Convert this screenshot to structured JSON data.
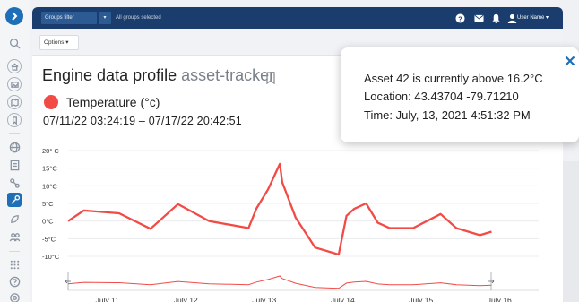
{
  "colors": {
    "topbar": "#1b3d6d",
    "accent": "#1f6fb8",
    "series": "#f24b46"
  },
  "toolbar": {
    "groups_filter": "Groups filter",
    "groups_caret": "▾",
    "groups_selected": "All groups selected",
    "icons": [
      "help-icon",
      "mail-icon",
      "bell-icon",
      "user-icon"
    ],
    "user_name": "User Name ▾",
    "options_label": "Options ▾"
  },
  "sidebar": {
    "items": [
      "expand-icon",
      "search-icon",
      "home-icon",
      "image-icon",
      "map-icon",
      "bookmark-icon",
      "globe-icon",
      "document-icon",
      "link-icon",
      "tools-icon",
      "leaf-icon",
      "people-icon",
      "grid-icon",
      "help-icon",
      "settings-icon"
    ]
  },
  "page": {
    "title": "Engine data profile",
    "asset": "asset-tracker",
    "legend_label": "Temperature (°c)",
    "date_range": "07/11/22 03:24:19 – 07/17/22 20:42:51"
  },
  "popup": {
    "line1": "Asset 42 is currently above 16.2°C",
    "line2": "Location: 43.43704  -79.71210",
    "line3": "Time: July, 13, 2021 4:51:32 PM"
  },
  "chart_data": {
    "type": "line",
    "title": "",
    "xlabel": "",
    "ylabel": "",
    "y_tick_labels": [
      "20° C",
      "15°C",
      "10°C",
      "5°C",
      "0°C",
      "-5°C",
      "-10°C"
    ],
    "x_tick_labels": [
      "July 11",
      "July 12",
      "July 13",
      "July 14",
      "July 15",
      "July 16"
    ],
    "ylim": [
      -10,
      20
    ],
    "xlim": [
      10.5,
      16.5
    ],
    "grid": true,
    "series": [
      {
        "name": "Temperature (°c)",
        "x": [
          10.5,
          10.7,
          11.15,
          11.55,
          11.9,
          12.3,
          12.8,
          12.9,
          13.05,
          13.2,
          13.23,
          13.4,
          13.65,
          13.95,
          14.05,
          14.15,
          14.3,
          14.45,
          14.6,
          14.9,
          15.25,
          15.45,
          15.75,
          15.9
        ],
        "y": [
          0,
          3,
          2.2,
          -2.2,
          4.8,
          0,
          -2,
          3.5,
          9,
          16.2,
          11,
          1,
          -7.5,
          -9.5,
          1.5,
          3.5,
          5,
          -0.5,
          -2,
          -2,
          2,
          -2,
          -4,
          -3
        ]
      }
    ],
    "navigator": {
      "x_range": [
        10.5,
        16.5
      ]
    }
  }
}
